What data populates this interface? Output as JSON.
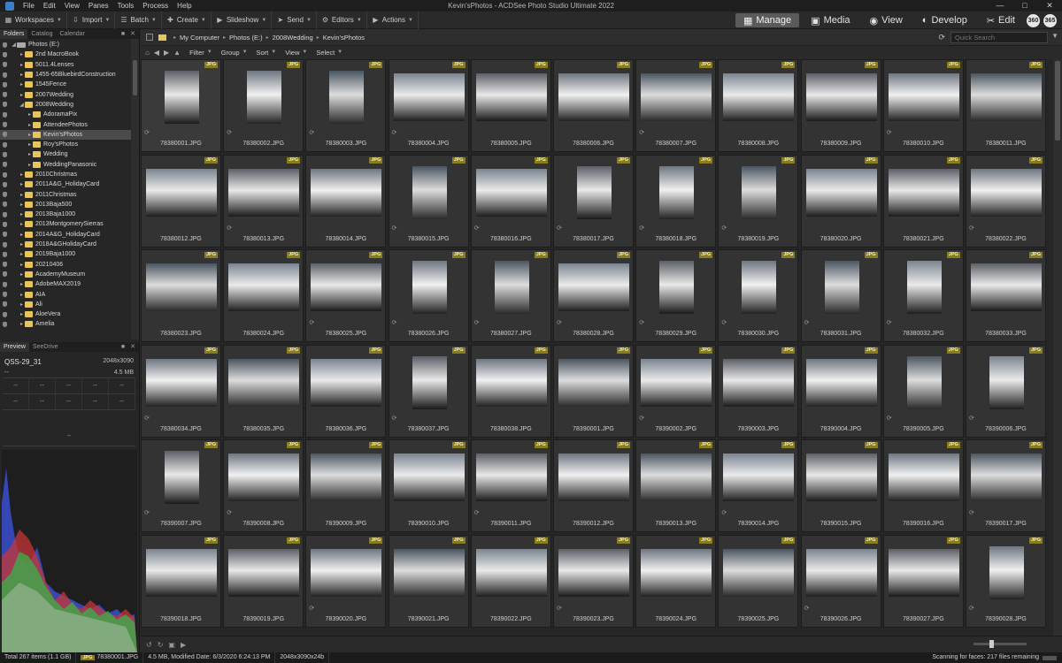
{
  "window": {
    "title": "Kevin'sPhotos - ACDSee Photo Studio Ultimate 2022",
    "menu": [
      "File",
      "Edit",
      "View",
      "Panes",
      "Tools",
      "Process",
      "Help"
    ]
  },
  "toolbar": {
    "items": [
      {
        "label": "Workspaces",
        "icon": "grid-icon"
      },
      {
        "label": "Import",
        "icon": "import-icon"
      },
      {
        "label": "Batch",
        "icon": "batch-icon"
      },
      {
        "label": "Create",
        "icon": "create-icon"
      },
      {
        "label": "Slideshow",
        "icon": "slideshow-icon"
      },
      {
        "label": "Send",
        "icon": "send-icon"
      },
      {
        "label": "Editors",
        "icon": "editors-icon"
      },
      {
        "label": "Actions",
        "icon": "actions-icon"
      }
    ],
    "modes": [
      {
        "label": "Manage",
        "icon": "manage-icon",
        "active": true
      },
      {
        "label": "Media",
        "icon": "media-icon",
        "active": false
      },
      {
        "label": "View",
        "icon": "eye-icon",
        "active": false
      },
      {
        "label": "Develop",
        "icon": "develop-icon",
        "active": false
      },
      {
        "label": "Edit",
        "icon": "edit-icon",
        "active": false
      }
    ],
    "extra_icon_1": "360",
    "extra_icon_2": "365"
  },
  "left_panel": {
    "tabs": [
      "Folders",
      "Catalog",
      "Calendar"
    ],
    "tree": [
      {
        "label": "Photos (E:)",
        "level": 0,
        "type": "drive",
        "expanded": true
      },
      {
        "label": "2nd MacroBook",
        "level": 1
      },
      {
        "label": "5011.4Lenses",
        "level": 1
      },
      {
        "label": "1455-65BluebirdConstruction",
        "level": 1
      },
      {
        "label": "1545Fence",
        "level": 1
      },
      {
        "label": "2007Wedding",
        "level": 1
      },
      {
        "label": "2008Wedding",
        "level": 1,
        "expanded": true
      },
      {
        "label": "AdoramaPix",
        "level": 2
      },
      {
        "label": "AttendeePhotos",
        "level": 2
      },
      {
        "label": "Kevin'sPhotos",
        "level": 2,
        "selected": true
      },
      {
        "label": "Roy'sPhotos",
        "level": 2
      },
      {
        "label": "Wedding",
        "level": 2,
        "collapsed": true
      },
      {
        "label": "WeddingPanasonic",
        "level": 2
      },
      {
        "label": "2010Christmas",
        "level": 1
      },
      {
        "label": "2011A&G_HolidayCard",
        "level": 1
      },
      {
        "label": "2011Christmas",
        "level": 1
      },
      {
        "label": "2013Baja500",
        "level": 1
      },
      {
        "label": "2013Baja1000",
        "level": 1
      },
      {
        "label": "2013MontgomerySierras",
        "level": 1
      },
      {
        "label": "2014A&G_HolidayCard",
        "level": 1
      },
      {
        "label": "2018A&GHolidayCard",
        "level": 1
      },
      {
        "label": "2019Baja1000",
        "level": 1
      },
      {
        "label": "20210406",
        "level": 1
      },
      {
        "label": "AcademyMuseum",
        "level": 1
      },
      {
        "label": "AdobeMAX2019",
        "level": 1
      },
      {
        "label": "AIA",
        "level": 1
      },
      {
        "label": "Ali",
        "level": 1
      },
      {
        "label": "AloeVera",
        "level": 1
      },
      {
        "label": "Amelia",
        "level": 1
      }
    ],
    "preview_tabs": [
      "Preview",
      "SeeDrive"
    ],
    "preview": {
      "name": "QSS-29_31",
      "dimensions": "2048x3090",
      "size": "4.5 MB",
      "dash": "--",
      "grid_cells": [
        "--",
        "--",
        "--",
        "--",
        "--",
        "--",
        "--",
        "--",
        "--",
        "--"
      ],
      "wide_cell": "--"
    }
  },
  "path": {
    "crumbs": [
      "My Computer",
      "Photos (E:)",
      "2008Wedding",
      "Kevin'sPhotos"
    ],
    "search_placeholder": "Quick Search"
  },
  "filterbar": {
    "items": [
      "Filter",
      "Group",
      "Sort",
      "View",
      "Select"
    ]
  },
  "grid": {
    "badge": "JPG",
    "files": [
      "78380001.JPG",
      "78380002.JPG",
      "78380003.JPG",
      "78380004.JPG",
      "78380005.JPG",
      "78380006.JPG",
      "78380007.JPG",
      "78380008.JPG",
      "78380009.JPG",
      "78380010.JPG",
      "78380011.JPG",
      "78380012.JPG",
      "78380013.JPG",
      "78380014.JPG",
      "78380015.JPG",
      "78380016.JPG",
      "78380017.JPG",
      "78380018.JPG",
      "78380019.JPG",
      "78380020.JPG",
      "78380021.JPG",
      "78380022.JPG",
      "78380023.JPG",
      "78380024.JPG",
      "78380025.JPG",
      "78380026.JPG",
      "78380027.JPG",
      "78380028.JPG",
      "78380029.JPG",
      "78380030.JPG",
      "78380031.JPG",
      "78380032.JPG",
      "78380033.JPG",
      "78380034.JPG",
      "78380035.JPG",
      "78380036.JPG",
      "78380037.JPG",
      "78380038.JPG",
      "78390001.JPG",
      "78390002.JPG",
      "78390003.JPG",
      "78390004.JPG",
      "78390005.JPG",
      "78390006.JPG",
      "78390007.JPG",
      "78390008.JPG",
      "78390009.JPG",
      "78390010.JPG",
      "78390011.JPG",
      "78390012.JPG",
      "78390013.JPG",
      "78390014.JPG",
      "78390015.JPG",
      "78390016.JPG",
      "78390017.JPG",
      "78390018.JPG",
      "78390019.JPG",
      "78390020.JPG",
      "78390021.JPG",
      "78390022.JPG",
      "78390023.JPG",
      "78390024.JPG",
      "78390025.JPG",
      "78390026.JPG",
      "78390027.JPG",
      "78390028.JPG"
    ],
    "portrait": [
      0,
      1,
      2,
      14,
      16,
      17,
      18,
      25,
      26,
      28,
      29,
      30,
      31,
      36,
      42,
      43,
      44,
      65
    ],
    "colors": {
      "badge_bg": "#8a7d1c",
      "accent": "#e8c55a",
      "selected_mode": "#5a5a5a"
    }
  },
  "status": {
    "total": "Total 267 items  (1.1 GB)",
    "badge": "JPG",
    "file": "78380001.JPG",
    "info": "4.5 MB, Modified Date: 6/3/2020 6:24:13 PM",
    "dims": "2048x3090x24b",
    "right": "Scanning for faces: 217 files remaining"
  }
}
